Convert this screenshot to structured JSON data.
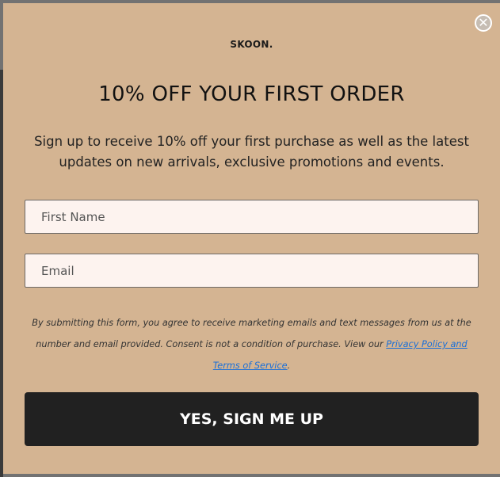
{
  "popup": {
    "close_icon": "close-circle-icon",
    "close_glyph": "✕",
    "logo": "SKOON.",
    "title": "10% OFF YOUR FIRST ORDER",
    "description": "Sign up to receive 10% off your first purchase as well as the latest updates on new arrivals, exclusive promotions and events.",
    "first_name_placeholder": "First Name",
    "email_placeholder": "Email",
    "legal_text": "By submitting this form, you agree to receive marketing emails and text messages from us at the number and email provided. Consent is not a condition of purchase. View our ",
    "legal_link": "Privacy Policy and Terms of Service",
    "legal_end": ".",
    "submit_label": "YES, SIGN ME UP"
  },
  "colors": {
    "background": "#d4b492",
    "button": "#212121",
    "input_bg": "#fdf3ef",
    "link": "#1a6fd8"
  }
}
